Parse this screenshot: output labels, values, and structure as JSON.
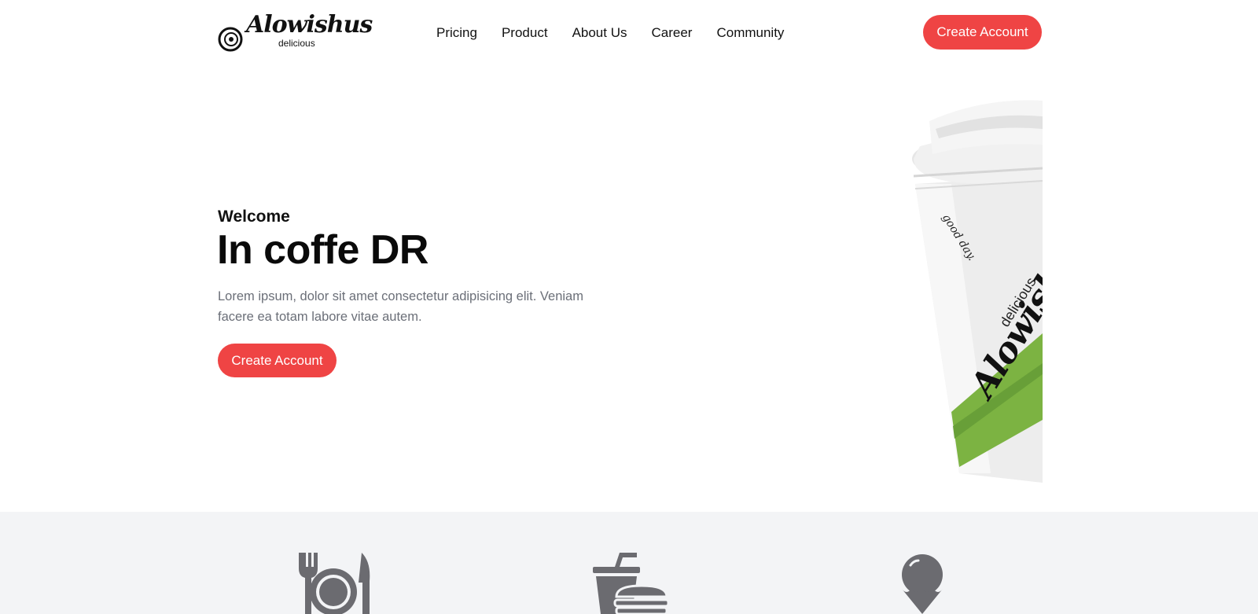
{
  "brand": {
    "name": "Alowishus",
    "tagline": "delicious",
    "accent_color": "#ef4444"
  },
  "nav": {
    "items": [
      {
        "label": "Pricing"
      },
      {
        "label": "Product"
      },
      {
        "label": "About Us"
      },
      {
        "label": "Career"
      },
      {
        "label": "Community"
      }
    ],
    "cta_label": "Create Account"
  },
  "hero": {
    "eyebrow": "Welcome",
    "title": "In coffe DR",
    "description": "Lorem ipsum, dolor sit amet consectetur adipisicing elit. Veniam facere ea totam labore vitae autem.",
    "cta_label": "Create Account",
    "image": {
      "icon": "coffee-cup-image",
      "cup_brand": "Alowishus",
      "cup_tagline": "delicious",
      "cup_script": "good day."
    }
  },
  "features": {
    "icons": [
      {
        "icon": "plate-cutlery-icon"
      },
      {
        "icon": "drink-burger-icon"
      },
      {
        "icon": "ice-cream-icon"
      }
    ]
  }
}
